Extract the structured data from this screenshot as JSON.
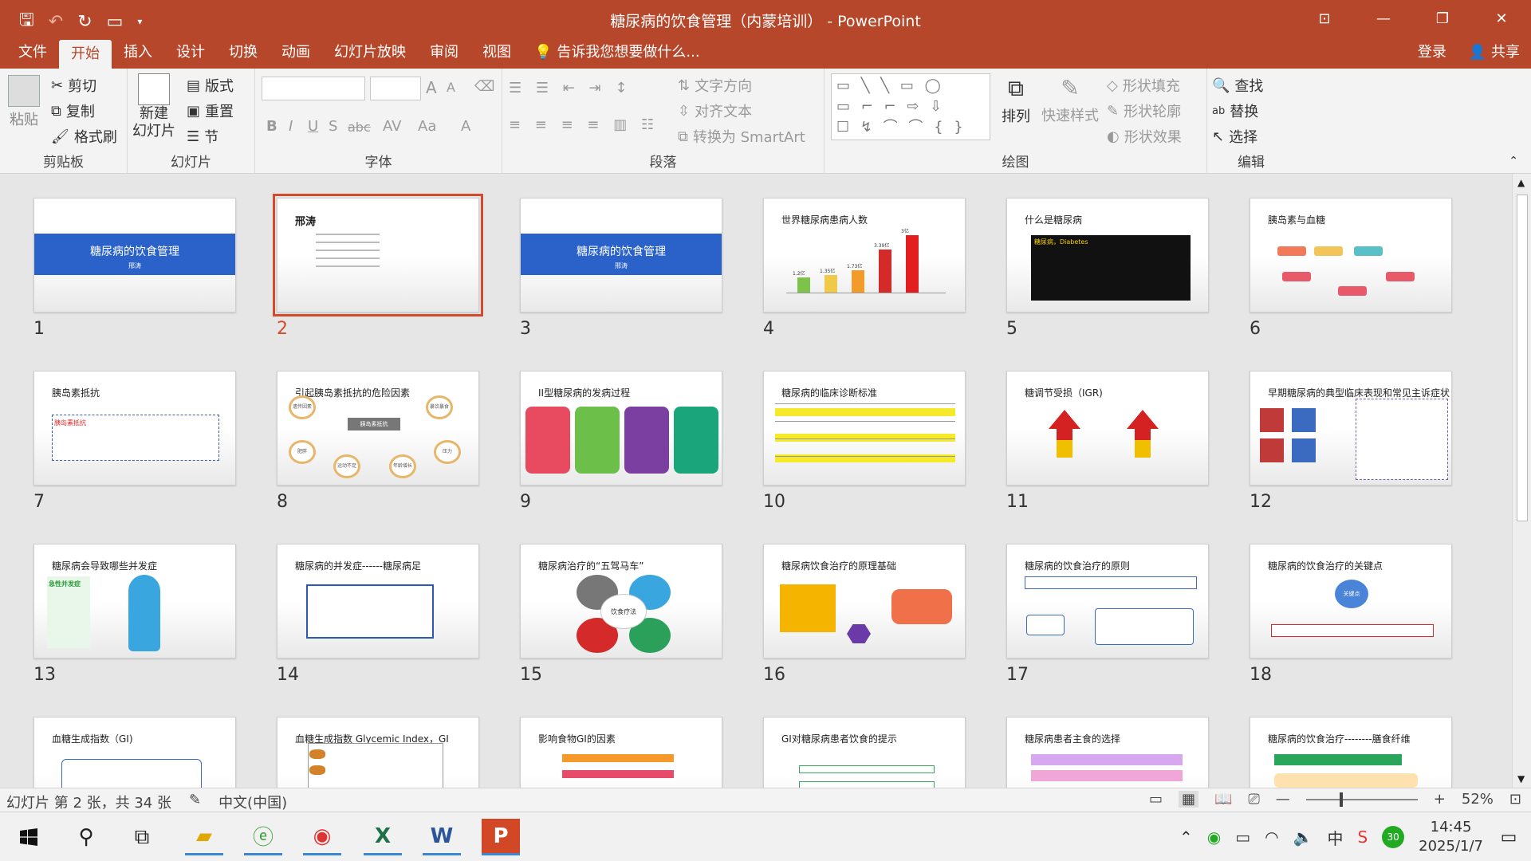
{
  "app": {
    "title": "糖尿病的饮食管理（内蒙培训） - PowerPoint",
    "accent": "#b7472a"
  },
  "qat": {
    "save_icon": "save-icon",
    "undo_icon": "undo-icon",
    "redo_icon": "redo-icon",
    "customize_icon": "present-icon"
  },
  "window_buttons": [
    "ribbon-display-icon",
    "minimize-icon",
    "restore-icon",
    "close-icon"
  ],
  "tabs": [
    "文件",
    "开始",
    "插入",
    "设计",
    "切换",
    "动画",
    "幻灯片放映",
    "审阅",
    "视图"
  ],
  "tellme": "告诉我您想要做什么...",
  "account": {
    "login": "登录",
    "share": "共享"
  },
  "ribbon": {
    "clipboard": {
      "label": "剪贴板",
      "paste": "粘贴",
      "cut": "剪切",
      "copy": "复制",
      "format_painter": "格式刷"
    },
    "slides": {
      "label": "幻灯片",
      "new_slide": "新建",
      "new_slide2": "幻灯片",
      "layout": "版式",
      "reset": "重置",
      "section": "节"
    },
    "font": {
      "label": "字体",
      "bold": "B",
      "italic": "I",
      "underline": "U",
      "shadow": "S",
      "strike": "abc",
      "spacing": "AV",
      "case": "Aa",
      "color": "A",
      "grow": "A",
      "shrink": "A"
    },
    "paragraph": {
      "label": "段落",
      "text_direction": "文字方向",
      "align_text": "对齐文本",
      "smartart": "转换为 SmartArt"
    },
    "drawing": {
      "label": "绘图",
      "arrange": "排列",
      "quick_styles": "快速样式",
      "fill": "形状填充",
      "outline": "形状轮廓",
      "effects": "形状效果"
    },
    "editing": {
      "label": "编辑",
      "find": "查找",
      "replace": "替换",
      "select": "选择"
    }
  },
  "slides": [
    {
      "n": "1",
      "title": "糖尿病的饮食管理",
      "sub": "邢涛"
    },
    {
      "n": "2",
      "title": "邢涛"
    },
    {
      "n": "3",
      "title": "糖尿病的饮食管理",
      "sub": "邢涛"
    },
    {
      "n": "4",
      "title": "世界糖尿病患病人数",
      "bars": [
        {
          "label": "1.2亿",
          "value": 1.2
        },
        {
          "label": "1.35亿",
          "value": 1.35
        },
        {
          "label": "1.73亿",
          "value": 1.73
        },
        {
          "label": "3.39亿",
          "value": 3.39
        },
        {
          "label": "3亿",
          "value": 4.5
        }
      ]
    },
    {
      "n": "5",
      "title": "什么是糖尿病",
      "sub": "糖尿病，Diabetes"
    },
    {
      "n": "6",
      "title": "胰岛素与血糖"
    },
    {
      "n": "7",
      "title": "胰岛素抵抗",
      "sub": "胰岛素抵抗"
    },
    {
      "n": "8",
      "title": "引起胰岛素抵抗的危险因素",
      "sub": "胰岛素抵抗",
      "items": [
        "遗传因素",
        "暴饮暴食",
        "肥胖",
        "运动不足",
        "年龄增长",
        "压力"
      ]
    },
    {
      "n": "9",
      "title": "II型糖尿病的发病过程"
    },
    {
      "n": "10",
      "title": "糖尿病的临床诊断标准"
    },
    {
      "n": "11",
      "title": "糖调节受损（IGR)"
    },
    {
      "n": "12",
      "title": "早期糖尿病的典型临床表现和常见主诉症状"
    },
    {
      "n": "13",
      "title": "糖尿病会导致哪些并发症",
      "sub": "急性并发症"
    },
    {
      "n": "14",
      "title": "糖尿病的并发症------糖尿病足"
    },
    {
      "n": "15",
      "title": "糖尿病治疗的“五驾马车”",
      "sub": "饮食疗法"
    },
    {
      "n": "16",
      "title": "糖尿病饮食治疗的原理基础"
    },
    {
      "n": "17",
      "title": "糖尿病的饮食治疗的原则"
    },
    {
      "n": "18",
      "title": "糖尿病的饮食治疗的关键点",
      "sub": "关键点"
    },
    {
      "n": "",
      "title": "血糖生成指数（GI)"
    },
    {
      "n": "",
      "title": "血糖生成指数 Glycemic Index，GI"
    },
    {
      "n": "",
      "title": "影响食物GI的因素"
    },
    {
      "n": "",
      "title": "GI对糖尿病患者饮食的提示"
    },
    {
      "n": "",
      "title": "糖尿病患者主食的选择"
    },
    {
      "n": "",
      "title": "糖尿病的饮食治疗--------膳食纤维"
    }
  ],
  "status": {
    "slide_info": "幻灯片 第 2 张，共 34 张",
    "language": "中文(中国)",
    "zoom": "52%"
  },
  "taskbar": {
    "time": "14:45",
    "date": "2025/1/7"
  }
}
